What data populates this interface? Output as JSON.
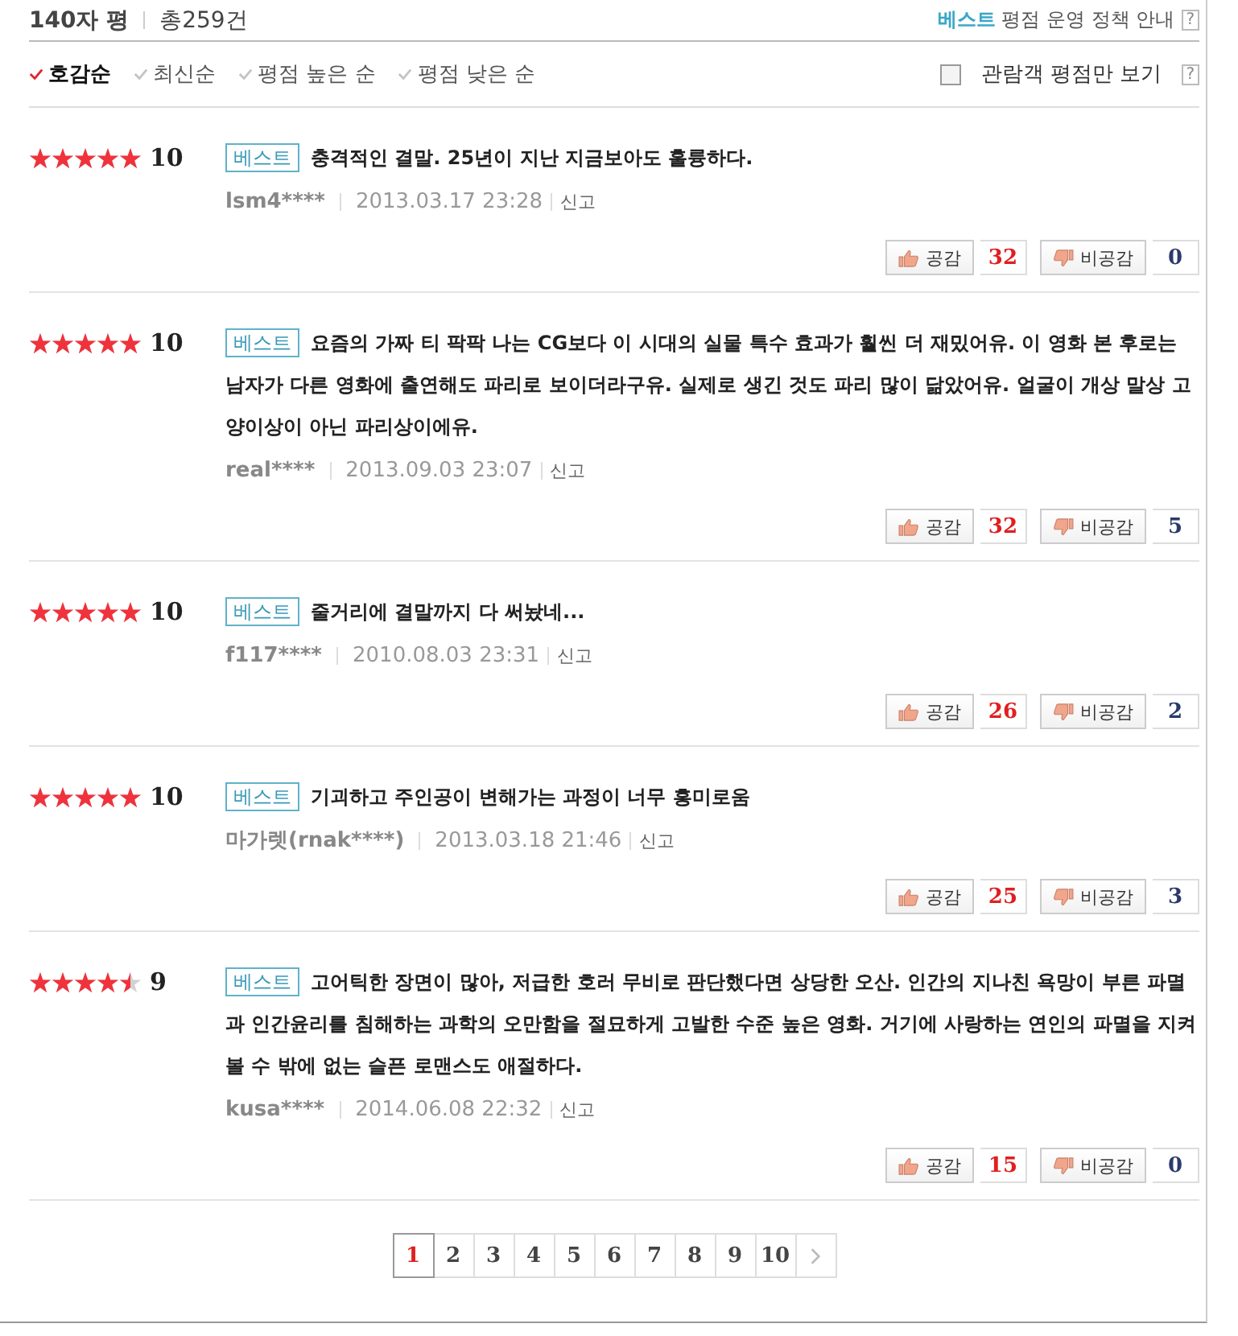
{
  "header": {
    "title": "140자 평",
    "total": "총259건",
    "policy_link": {
      "highlight": "베스트",
      "text": "평점 운영 정책 안내"
    },
    "help": "?"
  },
  "sort_options": [
    {
      "label": "호감순",
      "selected": true
    },
    {
      "label": "최신순",
      "selected": false
    },
    {
      "label": "평점 높은 순",
      "selected": false
    },
    {
      "label": "평점 낮은 순",
      "selected": false
    }
  ],
  "audience_filter": {
    "label": "관람객 평점만 보기",
    "checked": false,
    "help": "?"
  },
  "reviews": [
    {
      "stars": 5,
      "score": "10",
      "badge": "베스트",
      "text": "충격적인 결말. 25년이 지난 지금보아도 훌륭하다.",
      "user": "lsm4****",
      "date": "2013.03.17 23:28",
      "report": "신고",
      "like_label": "공감",
      "likes": "32",
      "dislike_label": "비공감",
      "dislikes": "0"
    },
    {
      "stars": 5,
      "score": "10",
      "badge": "베스트",
      "text": "요즘의 가짜 티 팍팍 나는 CG보다 이 시대의 실물 특수 효과가 훨씬 더 재밌어유. 이 영화 본 후로는 남자가 다른 영화에 출연해도 파리로 보이더라구유. 실제로 생긴 것도 파리 많이 닮았어유. 얼굴이 개상 말상 고양이상이 아닌 파리상이에유.",
      "user": "real****",
      "date": "2013.09.03 23:07",
      "report": "신고",
      "like_label": "공감",
      "likes": "32",
      "dislike_label": "비공감",
      "dislikes": "5"
    },
    {
      "stars": 5,
      "score": "10",
      "badge": "베스트",
      "text": "줄거리에 결말까지 다 써놨네...",
      "user": "f117****",
      "date": "2010.08.03 23:31",
      "report": "신고",
      "like_label": "공감",
      "likes": "26",
      "dislike_label": "비공감",
      "dislikes": "2"
    },
    {
      "stars": 5,
      "score": "10",
      "badge": "베스트",
      "text": "기괴하고 주인공이 변해가는 과정이 너무 흥미로움",
      "user": "마가렛(rnak****)",
      "date": "2013.03.18 21:46",
      "report": "신고",
      "like_label": "공감",
      "likes": "25",
      "dislike_label": "비공감",
      "dislikes": "3"
    },
    {
      "stars": 4.5,
      "score": "9",
      "badge": "베스트",
      "text": "고어틱한 장면이 많아, 저급한 호러 무비로 판단했다면 상당한 오산. 인간의 지나친 욕망이 부른 파멸과 인간윤리를 침해하는 과학의 오만함을 절묘하게 고발한 수준 높은 영화. 거기에 사랑하는 연인의 파멸을 지켜 볼 수 밖에 없는 슬픈 로맨스도 애절하다.",
      "user": "kusa****",
      "date": "2014.06.08 22:32",
      "report": "신고",
      "like_label": "공감",
      "likes": "15",
      "dislike_label": "비공감",
      "dislikes": "0"
    }
  ],
  "pagination": {
    "pages": [
      {
        "label": "1",
        "selected": true
      },
      {
        "label": "2",
        "selected": false
      },
      {
        "label": "3",
        "selected": false
      },
      {
        "label": "4",
        "selected": false
      },
      {
        "label": "5",
        "selected": false
      },
      {
        "label": "6",
        "selected": false
      },
      {
        "label": "7",
        "selected": false
      },
      {
        "label": "8",
        "selected": false
      },
      {
        "label": "9",
        "selected": false
      },
      {
        "label": "10",
        "selected": false
      }
    ]
  }
}
